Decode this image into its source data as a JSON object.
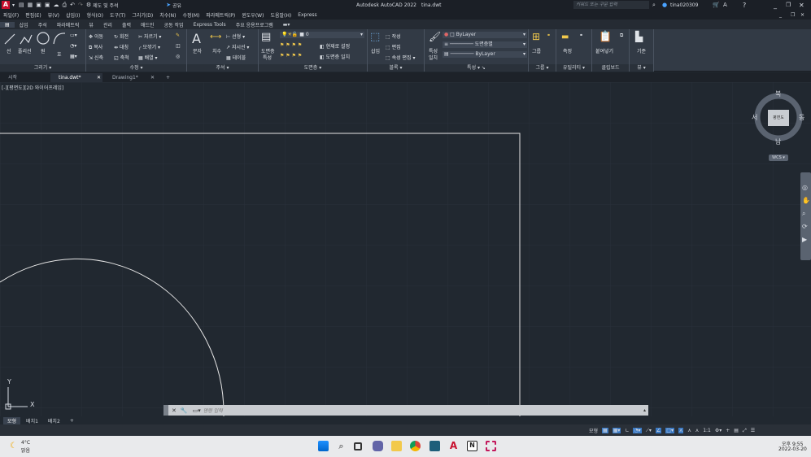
{
  "title": {
    "quick_access_label": "제도 및 주석",
    "share_label": "공유",
    "app_title": "Autodesk AutoCAD 2022",
    "file_title": "tina.dwt",
    "search_placeholder": "키워드 또는 구문 입력",
    "user": "tina020309"
  },
  "menu": [
    "파일(F)",
    "편집(E)",
    "뷰(V)",
    "삽입(I)",
    "형식(O)",
    "도구(T)",
    "그리기(D)",
    "치수(N)",
    "수정(M)",
    "파라메트릭(P)",
    "윈도우(W)",
    "도움말(H)",
    "Express"
  ],
  "ribbon_tabs": [
    "홈",
    "삽입",
    "주석",
    "파라메트릭",
    "뷰",
    "관리",
    "출력",
    "애드인",
    "공동 작업",
    "Express Tools",
    "주요 응용프로그램"
  ],
  "ribbon": {
    "draw": {
      "line": "선",
      "polyline": "폴리선",
      "circle": "원",
      "arc": "호",
      "label": "그리기"
    },
    "modify": {
      "move": "이동",
      "rotate": "회전",
      "trim": "자르기",
      "copy": "복사",
      "mirror": "대칭",
      "fillet": "모깎기",
      "stretch": "신축",
      "scale": "축척",
      "array": "배열",
      "label": "수정"
    },
    "annotation": {
      "text": "문자",
      "dimension": "치수",
      "linear": "선형",
      "leader": "지시선",
      "table": "테이블",
      "label": "주석"
    },
    "layers": {
      "layer_props": "도면층",
      "layer_props2": "특성",
      "current_layer": "0",
      "make_current": "현재로 설정",
      "match_layer": "도면층 일치",
      "label": "도면층"
    },
    "block": {
      "insert": "삽입",
      "create": "작성",
      "edit": "편집",
      "edit_attr": "속성 편집",
      "label": "블록"
    },
    "properties": {
      "match_props": "특성",
      "match_props2": "일치",
      "color": "ByLayer",
      "lineweight": "도면층별",
      "linetype": "ByLayer",
      "label": "특성"
    },
    "groups": {
      "group": "그룹",
      "label": "그룹"
    },
    "utilities": {
      "measure": "측정",
      "label": "유틸리티"
    },
    "clipboard": {
      "paste": "붙여넣기",
      "label": "클립보드"
    },
    "view": {
      "base": "기준",
      "label": "뷰"
    }
  },
  "doc_tabs": [
    "시작",
    "tina.dwt*",
    "Drawing1*"
  ],
  "view_label": "[-][평면도][2D 와이어프레임]",
  "viewcube": {
    "north": "북",
    "south": "남",
    "east": "동",
    "west": "서",
    "face": "평면도",
    "wcs": "WCS"
  },
  "ucs": {
    "x": "X",
    "y": "Y"
  },
  "command": {
    "placeholder": "명령 입력"
  },
  "layout_tabs": [
    "모형",
    "배치1",
    "배치2"
  ],
  "status": {
    "model": "모형",
    "scale": "1:1"
  },
  "taskbar": {
    "temp": "4°C",
    "weather": "맑음",
    "time": "오후 9:55",
    "date": "2022-03-20"
  }
}
